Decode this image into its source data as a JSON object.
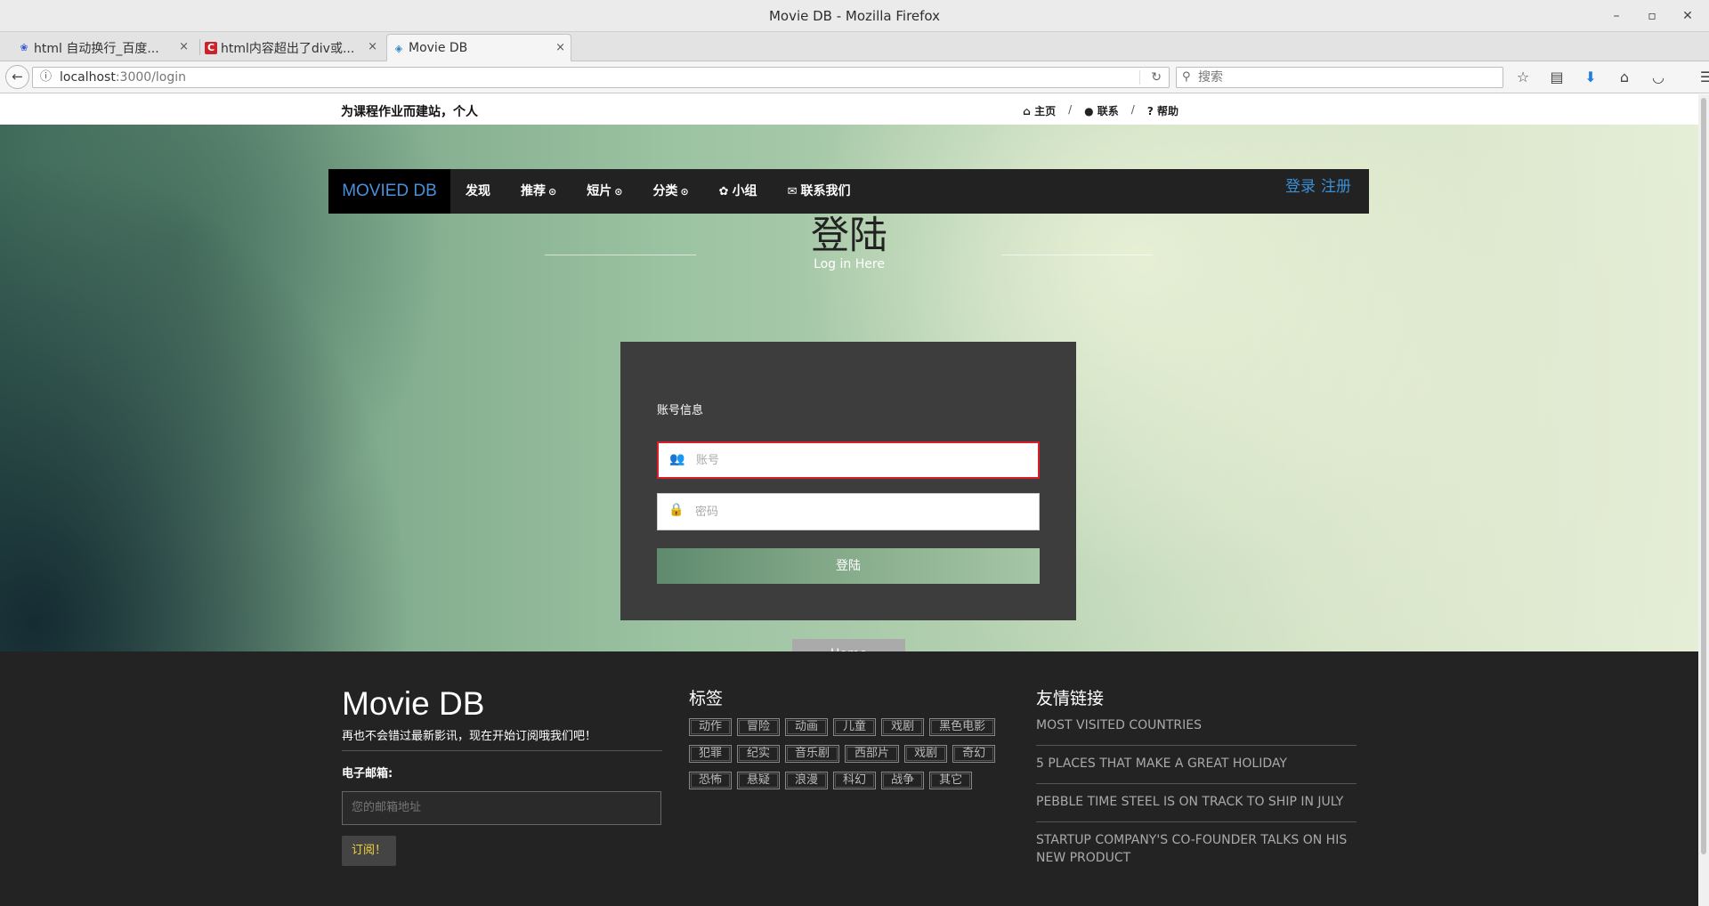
{
  "window": {
    "title": "Movie DB - Mozilla Firefox",
    "minimize": "–",
    "maximize": "▫",
    "close": "✕"
  },
  "tabs": [
    {
      "label": "html 自动换行_百度...",
      "icon": "baidu-paw-icon",
      "close": "×"
    },
    {
      "label": "html内容超出了div或...",
      "icon": "csdn-c-icon",
      "close": "×"
    },
    {
      "label": "Movie DB",
      "icon": "moviedb-icon",
      "close": "×"
    }
  ],
  "browser": {
    "new_tab": "+",
    "url_host": "localhost",
    "url_path": ":3000/login",
    "search_placeholder": "搜索"
  },
  "site": {
    "slogan": "为课程作业而建站，个人",
    "top_links": [
      "主页",
      "联系",
      "帮助"
    ],
    "top_link_sep": "/",
    "brand": "MOVIED DB",
    "nav": [
      "发现",
      "推荐",
      "短片",
      "分类",
      "小组",
      "联系我们"
    ],
    "auth_login": "登录",
    "auth_register": "注册"
  },
  "login": {
    "title": "登陆",
    "subtitle": "Log in Here",
    "section_label": "账号信息",
    "account_placeholder": "账号",
    "password_placeholder": "密码",
    "submit": "登陆",
    "home": "Home"
  },
  "footer": {
    "brand": "Movie DB",
    "tagline": "再也不会错过最新影讯，现在开始订阅哦我们吧！",
    "email_label": "电子邮箱:",
    "email_placeholder": "您的邮箱地址",
    "subscribe": "订阅！",
    "tags_title": "标签",
    "tags": [
      "动作",
      "冒险",
      "动画",
      "儿童",
      "戏剧",
      "黑色电影",
      "犯罪",
      "纪实",
      "音乐剧",
      "西部片",
      "戏剧",
      "奇幻",
      "恐怖",
      "悬疑",
      "浪漫",
      "科幻",
      "战争",
      "其它"
    ],
    "links_title": "友情链接",
    "links": [
      "MOST VISITED COUNTRIES",
      "5 PLACES THAT MAKE A GREAT HOLIDAY",
      "PEBBLE TIME STEEL IS ON TRACK TO SHIP IN JULY",
      "STARTUP COMPANY'S CO-FOUNDER TALKS ON HIS NEW PRODUCT"
    ]
  }
}
